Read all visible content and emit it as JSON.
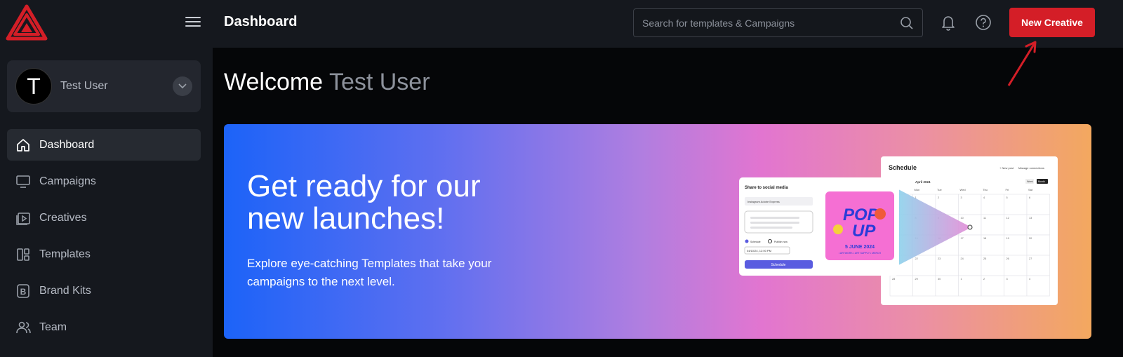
{
  "header": {
    "title": "Dashboard",
    "new_button": "New Creative"
  },
  "search": {
    "placeholder": "Search for templates & Campaigns"
  },
  "user": {
    "initial": "T",
    "name": "Test User"
  },
  "sidebar": {
    "items": [
      {
        "label": "Dashboard",
        "icon": "home-icon",
        "active": true
      },
      {
        "label": "Campaigns",
        "icon": "monitor-icon"
      },
      {
        "label": "Creatives",
        "icon": "play-icon"
      },
      {
        "label": "Templates",
        "icon": "layout-icon"
      },
      {
        "label": "Brand Kits",
        "icon": "b-icon"
      },
      {
        "label": "Team",
        "icon": "users-icon"
      }
    ]
  },
  "welcome": {
    "prefix": "Welcome",
    "name": "Test User"
  },
  "banner": {
    "title": "Get ready for our new launches!",
    "subtitle": "Explore eye-catching Templates that take your campaigns to the next level."
  },
  "illustration": {
    "share_title": "Share to social media",
    "share_account": "Instagram  Adobe Express",
    "schedule_option": "Schedule",
    "publish_option": "Publish now",
    "datetime": "04/10/24, 12:00 PM",
    "schedule_button": "Schedule",
    "poster_top": "POP",
    "poster_bottom": "UP",
    "poster_date": "5 JUNE 2024",
    "poster_tags": "• ARTWORK • ART SUPPLY • MERCH",
    "calendar_title": "Schedule",
    "calendar_new_post": "+ New post",
    "calendar_manage": "Manage connections",
    "calendar_today": "Today",
    "calendar_month": "April 2024",
    "calendar_week": "Week",
    "calendar_month_btn": "Month",
    "calendar_days": [
      "Sun",
      "Mon",
      "Tue",
      "Wed",
      "Thu",
      "Fri",
      "Sat"
    ],
    "calendar_dates": [
      "31",
      "1",
      "2",
      "3",
      "4",
      "5",
      "6",
      "7",
      "8",
      "9",
      "10",
      "11",
      "12",
      "13",
      "14",
      "15",
      "16",
      "17",
      "18",
      "19",
      "20",
      "21",
      "22",
      "23",
      "24",
      "25",
      "26",
      "27",
      "28",
      "29",
      "30",
      "1",
      "2",
      "3",
      "4"
    ]
  },
  "colors": {
    "accent": "#d41e27",
    "sidebar": "#15181e",
    "active_nav": "#262a31",
    "schedule_button": "#5a5ce0"
  }
}
